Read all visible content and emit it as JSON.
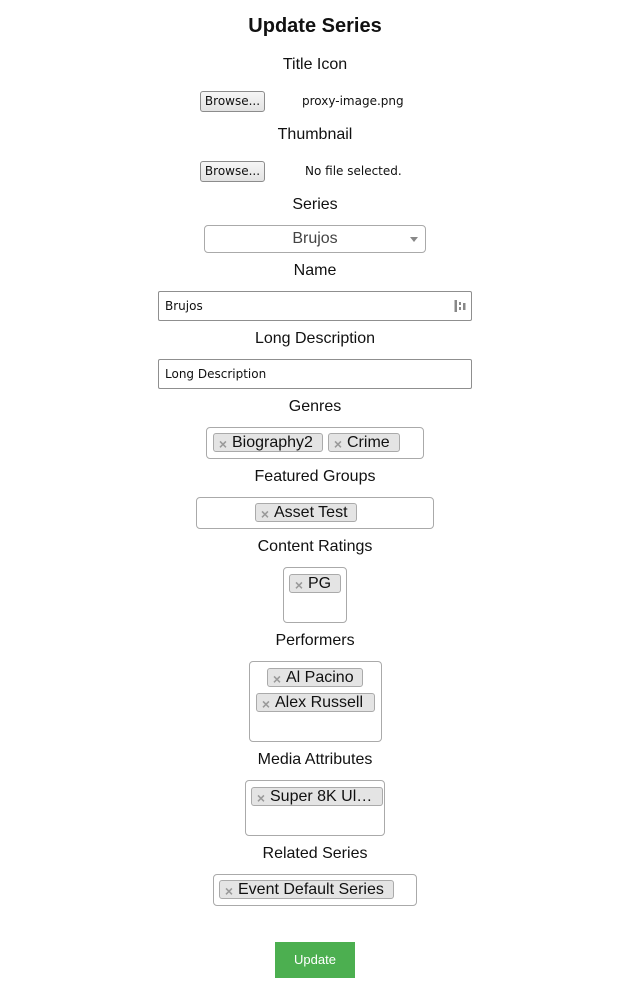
{
  "page": {
    "title": "Update Series"
  },
  "title_icon": {
    "label": "Title Icon",
    "browse_label": "Browse...",
    "file_name": "proxy-image.png"
  },
  "thumbnail": {
    "label": "Thumbnail",
    "browse_label": "Browse...",
    "file_name": "No file selected."
  },
  "series": {
    "label": "Series",
    "selected": "Brujos"
  },
  "name": {
    "label": "Name",
    "value": "Brujos"
  },
  "long_description": {
    "label": "Long Description",
    "placeholder": "Long Description"
  },
  "genres": {
    "label": "Genres",
    "tags": [
      "Biography2",
      "Crime"
    ]
  },
  "featured_groups": {
    "label": "Featured Groups",
    "tags": [
      "Asset Test"
    ]
  },
  "content_ratings": {
    "label": "Content Ratings",
    "tags": [
      "PG"
    ]
  },
  "performers": {
    "label": "Performers",
    "tags": [
      "Al Pacino",
      "Alex Russell"
    ]
  },
  "media_attributes": {
    "label": "Media Attributes",
    "tags": [
      "Super 8K Ult…"
    ]
  },
  "related_series": {
    "label": "Related Series",
    "tags": [
      "Event Default Series"
    ]
  },
  "actions": {
    "update_label": "Update",
    "remove_glyph": "×",
    "update_color": "#4caf50"
  }
}
